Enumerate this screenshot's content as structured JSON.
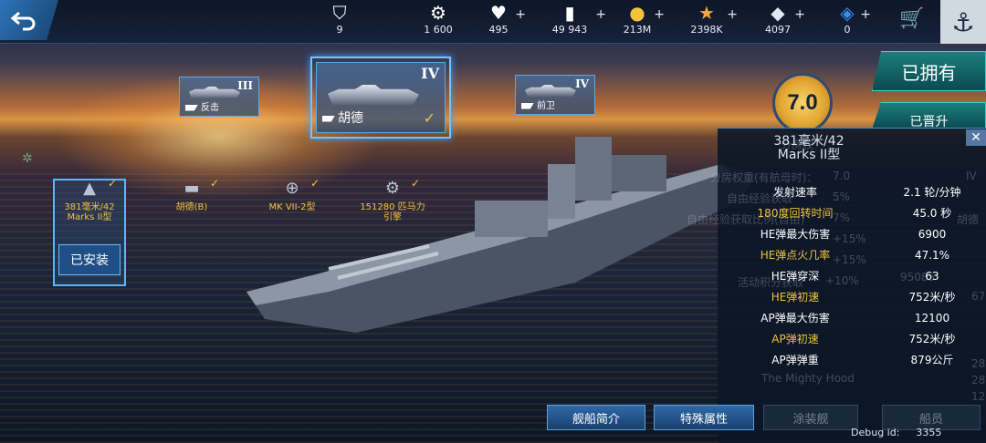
{
  "resources": [
    {
      "icon": "rank-badge-icon",
      "value": "9",
      "plus": false
    },
    {
      "icon": "ship-coin-icon",
      "value": "1 600",
      "plus": false
    },
    {
      "icon": "heart-icon",
      "value": "495",
      "plus": true
    },
    {
      "icon": "card-icon",
      "value": "49 943",
      "plus": true
    },
    {
      "icon": "gold-coin-icon",
      "value": "213M",
      "plus": true
    },
    {
      "icon": "star-icon",
      "value": "2398K",
      "plus": true
    },
    {
      "icon": "diamond-icon",
      "value": "4097",
      "plus": true
    },
    {
      "icon": "gem-icon",
      "value": "0",
      "plus": true
    }
  ],
  "plus_sign": "+",
  "ships": [
    {
      "name": "反击",
      "tier": "III"
    },
    {
      "name": "胡德",
      "tier": "IV"
    },
    {
      "name": "前卫",
      "tier": "IV"
    }
  ],
  "rating": "7.0",
  "owned_label": "已拥有",
  "promoted_label": "已晋升",
  "slots": [
    {
      "label": "381毫米/42 Marks II型"
    },
    {
      "label": "胡德(B)"
    },
    {
      "label": "MK VII-2型"
    },
    {
      "label": "151280 匹马力 引擎"
    }
  ],
  "installed_label": "已安装",
  "panel": {
    "title_line1": "381毫米/42",
    "title_line2": "Marks II型",
    "stats": [
      {
        "label": "发射速率",
        "value": "2.1 轮/分钟",
        "hl": false
      },
      {
        "label": "180度回转时间",
        "value": "45.0 秒",
        "hl": true
      },
      {
        "label": "HE弹最大伤害",
        "value": "6900",
        "hl": false
      },
      {
        "label": "HE弹点火几率",
        "value": "47.1%",
        "hl": true
      },
      {
        "label": "HE弹穿深",
        "value": "63",
        "hl": false
      },
      {
        "label": "HE弹初速",
        "value": "752米/秒",
        "hl": true
      },
      {
        "label": "AP弹最大伤害",
        "value": "12100",
        "hl": false
      },
      {
        "label": "AP弹初速",
        "value": "752米/秒",
        "hl": true
      },
      {
        "label": "AP弹弹重",
        "value": "879公斤",
        "hl": false
      }
    ],
    "ghost_lines": [
      "分房权",
      "分房权重(有航母时)：",
      "7.0",
      "IV",
      "自由经验获取",
      "5%",
      "自由经验获取比例(自由)",
      "7%",
      "胡德",
      "+15%",
      "+15%",
      "活动积分获取",
      "+10%",
      "95085",
      "The Mighty Hood",
      "67",
      "28",
      "28",
      "12"
    ]
  },
  "bottom_buttons": [
    {
      "label": "舰船简介",
      "dim": false
    },
    {
      "label": "特殊属性",
      "dim": false
    },
    {
      "label": "涂装舰",
      "dim": true
    },
    {
      "label": "船员",
      "dim": true
    }
  ],
  "debug_label": "Debug id:",
  "debug_id": "3355",
  "colors": {
    "accent": "#f2c33c",
    "frame": "#6fc6ff",
    "teal": "#1b7f7a"
  }
}
